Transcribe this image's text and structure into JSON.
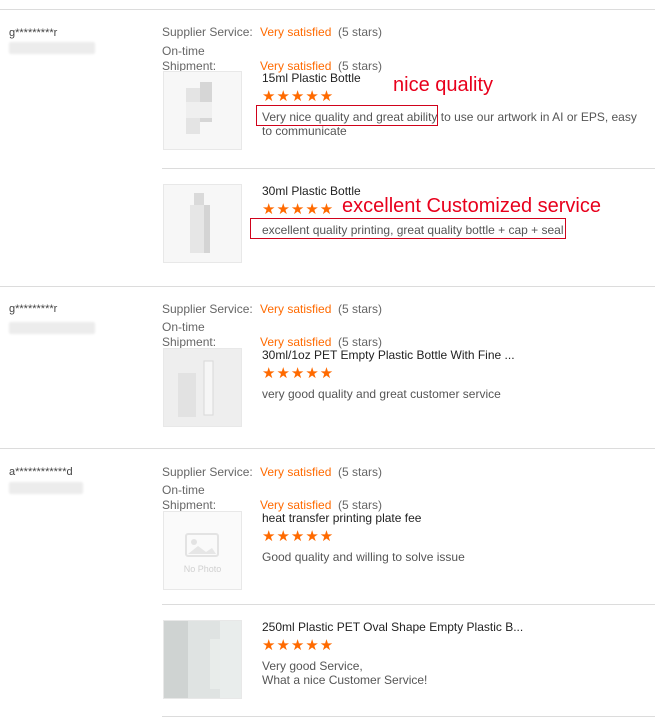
{
  "reviews": [
    {
      "user": "g*********r",
      "supplier_label": "Supplier Service:",
      "supplier_value": "Very satisfied",
      "supplier_stars": "(5 stars)",
      "ontime_label": "On-time",
      "shipment_label": "Shipment:",
      "shipment_value": "Very satisfied",
      "shipment_stars": "(5 stars)",
      "items": [
        {
          "name": "15ml Plastic Bottle",
          "stars": "★★★★★",
          "comment": "Very nice quality and great ability to use our artwork in AI or EPS, easy to communicate"
        },
        {
          "name": "30ml Plastic Bottle",
          "stars": "★★★★★",
          "comment": "excellent quality printing, great quality bottle + cap + seal"
        }
      ]
    },
    {
      "user": "g*********r",
      "supplier_label": "Supplier Service:",
      "supplier_value": "Very satisfied",
      "supplier_stars": "(5 stars)",
      "ontime_label": "On-time",
      "shipment_label": "Shipment:",
      "shipment_value": "Very satisfied",
      "shipment_stars": "(5 stars)",
      "items": [
        {
          "name": "30ml/1oz PET Empty Plastic Bottle With Fine ...",
          "stars": "★★★★★",
          "comment": "very good quality and great customer service"
        }
      ]
    },
    {
      "user": "a************d",
      "supplier_label": "Supplier Service:",
      "supplier_value": "Very satisfied",
      "supplier_stars": "(5 stars)",
      "ontime_label": "On-time",
      "shipment_label": "Shipment:",
      "shipment_value": "Very satisfied",
      "shipment_stars": "(5 stars)",
      "items": [
        {
          "name": "heat transfer printing plate fee",
          "stars": "★★★★★",
          "comment": "Good quality and willing to solve issue",
          "photo_placeholder": "No Photo"
        },
        {
          "name": "250ml Plastic PET Oval Shape Empty Plastic B...",
          "stars": "★★★★★",
          "comment_line1": "Very good Service,",
          "comment_line2": "What a nice Customer Service!"
        }
      ]
    }
  ],
  "annotations": {
    "first": "nice quality",
    "second": "excellent Customized service"
  },
  "colors": {
    "accent": "#ff6a00",
    "annotation": "#e8001c"
  }
}
